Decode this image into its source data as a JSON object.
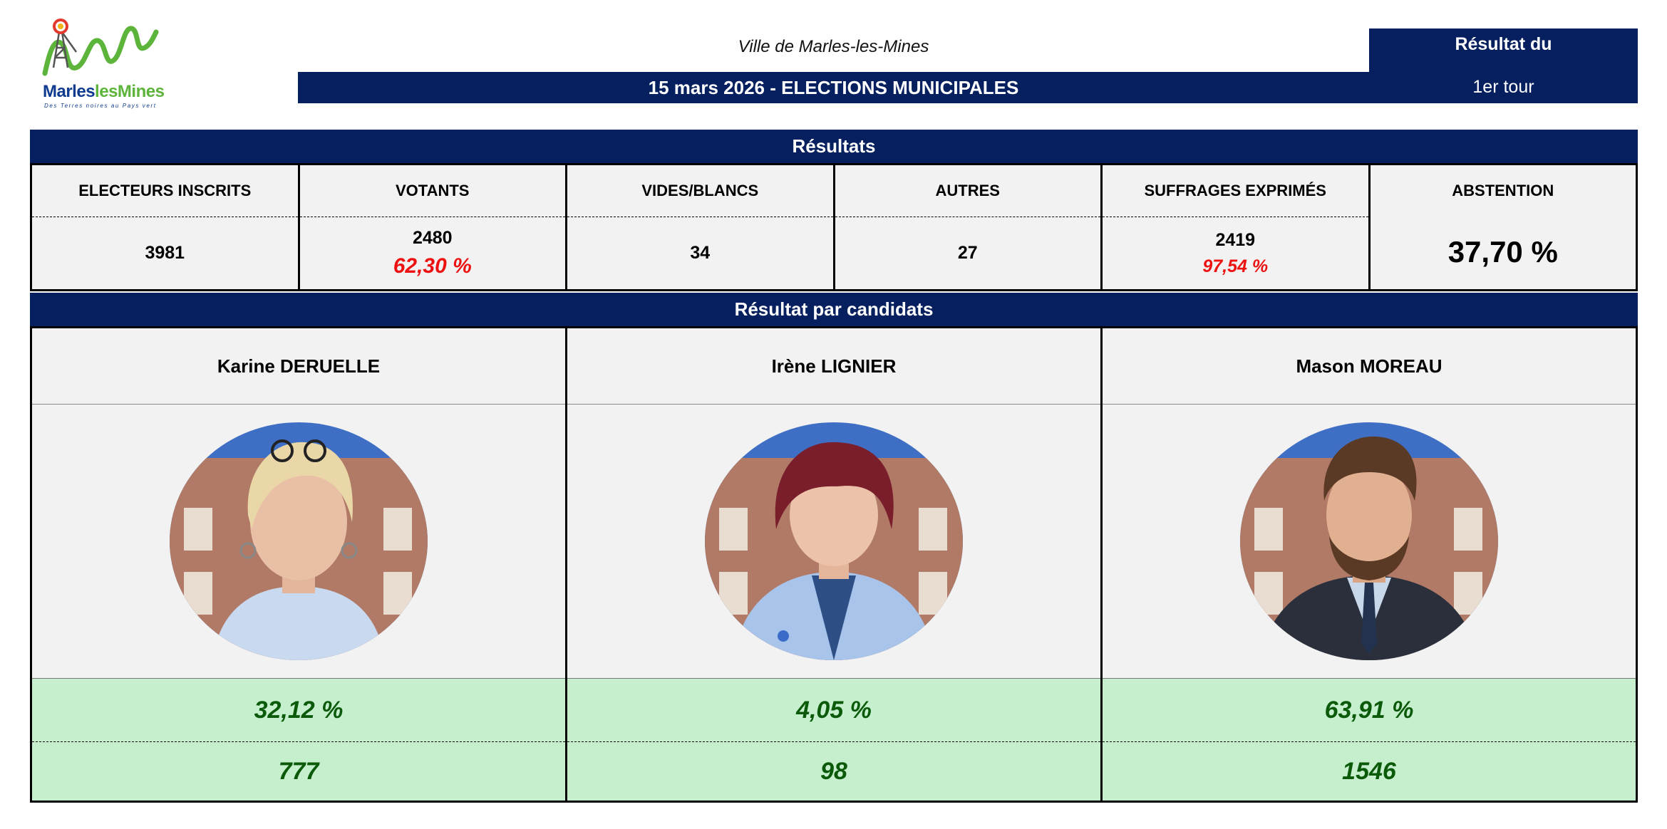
{
  "logo": {
    "name_part1": "Marles",
    "name_part2": "lesMines",
    "tagline": "Des Terres noires au Pays vert"
  },
  "header": {
    "city": "Ville de Marles-les-Mines",
    "date_title": "15 mars 2026 - ELECTIONS MUNICIPALES",
    "round_line1": "Résultat du",
    "round_line2": "1er tour"
  },
  "results": {
    "title": "Résultats",
    "registered": {
      "label": "ELECTEURS INSCRITS",
      "value": "3981"
    },
    "voters": {
      "label": "VOTANTS",
      "value": "2480",
      "pct": "62,30 %"
    },
    "blank": {
      "label": "VIDES/BLANCS",
      "value": "34"
    },
    "others": {
      "label": "AUTRES",
      "value": "27"
    },
    "expressed": {
      "label": "SUFFRAGES EXPRIMÉS",
      "value": "2419",
      "pct": "97,54 %"
    },
    "abstention": {
      "label": "ABSTENTION",
      "pct": "37,70 %"
    }
  },
  "candidates_section": {
    "title": "Résultat par candidats",
    "candidates": [
      {
        "name": "Karine DERUELLE",
        "pct": "32,12 %",
        "votes": "777",
        "photo_icon": "woman-blonde-portrait"
      },
      {
        "name": "Irène LIGNIER",
        "pct": "4,05 %",
        "votes": "98",
        "photo_icon": "woman-redhair-portrait"
      },
      {
        "name": "Mason MOREAU",
        "pct": "63,91 %",
        "votes": "1546",
        "photo_icon": "man-suit-portrait"
      }
    ]
  },
  "colors": {
    "navy": "#061f5e",
    "cell_grey": "#f2f2f2",
    "result_green_bg": "#c6efce",
    "result_green_text": "#0a5a0a",
    "pct_red": "#ee1111"
  }
}
